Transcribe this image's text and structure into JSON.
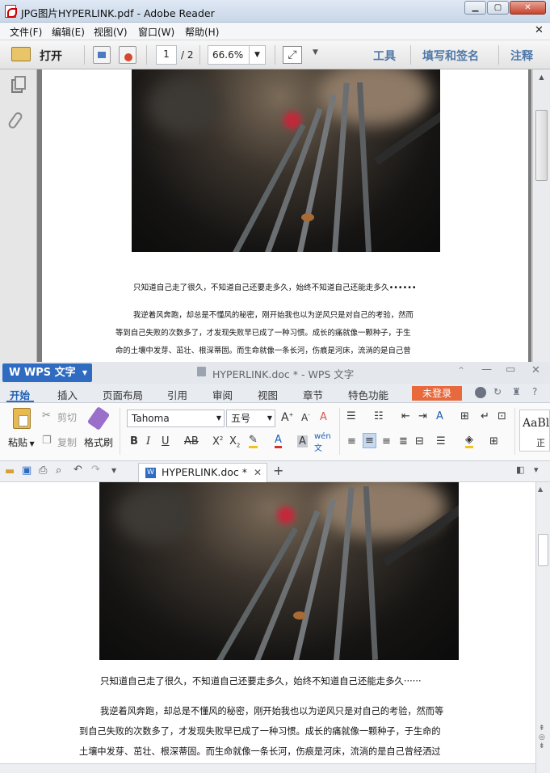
{
  "reader": {
    "title": "JPG图片HYPERLINK.pdf - Adobe Reader",
    "menu": [
      "文件(F)",
      "编辑(E)",
      "视图(V)",
      "窗口(W)",
      "帮助(H)"
    ],
    "open_label": "打开",
    "page_current": "1",
    "page_total": "/ 2",
    "zoom": "66.6%",
    "tools_label": "工具",
    "sign_label": "填写和签名",
    "comment_label": "注释",
    "caption": "只知道自己走了很久，不知道自己还要走多久，始终不知道自己还能走多久••••••",
    "para_lines": [
      "我逆着风奔跑，却总是不懂风的秘密，刚开始我也以为逆风只是对自己的考验，然而",
      "等到自己失败的次数多了，才发现失败早已成了一种习惯。成长的痛就像一颗种子，于生",
      "命的土壤中发芽、茁壮、根深蒂固。而生命就像一条长河，伤痕是河床，流淌的是自己曾"
    ]
  },
  "wps": {
    "app_label": "WPS 文字",
    "title": "HYPERLINK.doc * - WPS 文字",
    "tabs": [
      "开始",
      "插入",
      "页面布局",
      "引用",
      "审阅",
      "视图",
      "章节",
      "特色功能"
    ],
    "login_label": "未登录",
    "paste_label": "粘贴",
    "cut_label": "剪切",
    "copy_label": "复制",
    "format_painter_label": "格式刷",
    "font_name": "Tahoma",
    "font_size": "五号",
    "style_preview": "AaBl",
    "style_preview_sub": "正",
    "doc_tab": "HYPERLINK.doc *",
    "caption": "只知道自己走了很久，不知道自己还要走多久，始终不知道自己还能走多久······",
    "para_lines": [
      "我逆着风奔跑，却总是不懂风的秘密，刚开始我也以为逆风只是对自己的考验，然而等",
      "到自己失败的次数多了，才发现失败早已成了一种习惯。成长的痛就像一颗种子，于生命的",
      "土壤中发芽、茁壮、根深蒂固。而生命就像一条长河，伤痕是河床，流淌的是自己曾经洒过"
    ]
  },
  "colors": {
    "wps_blue": "#2f6bc1",
    "login_orange": "#e8693c",
    "reader_accent": "#4f78a8"
  }
}
